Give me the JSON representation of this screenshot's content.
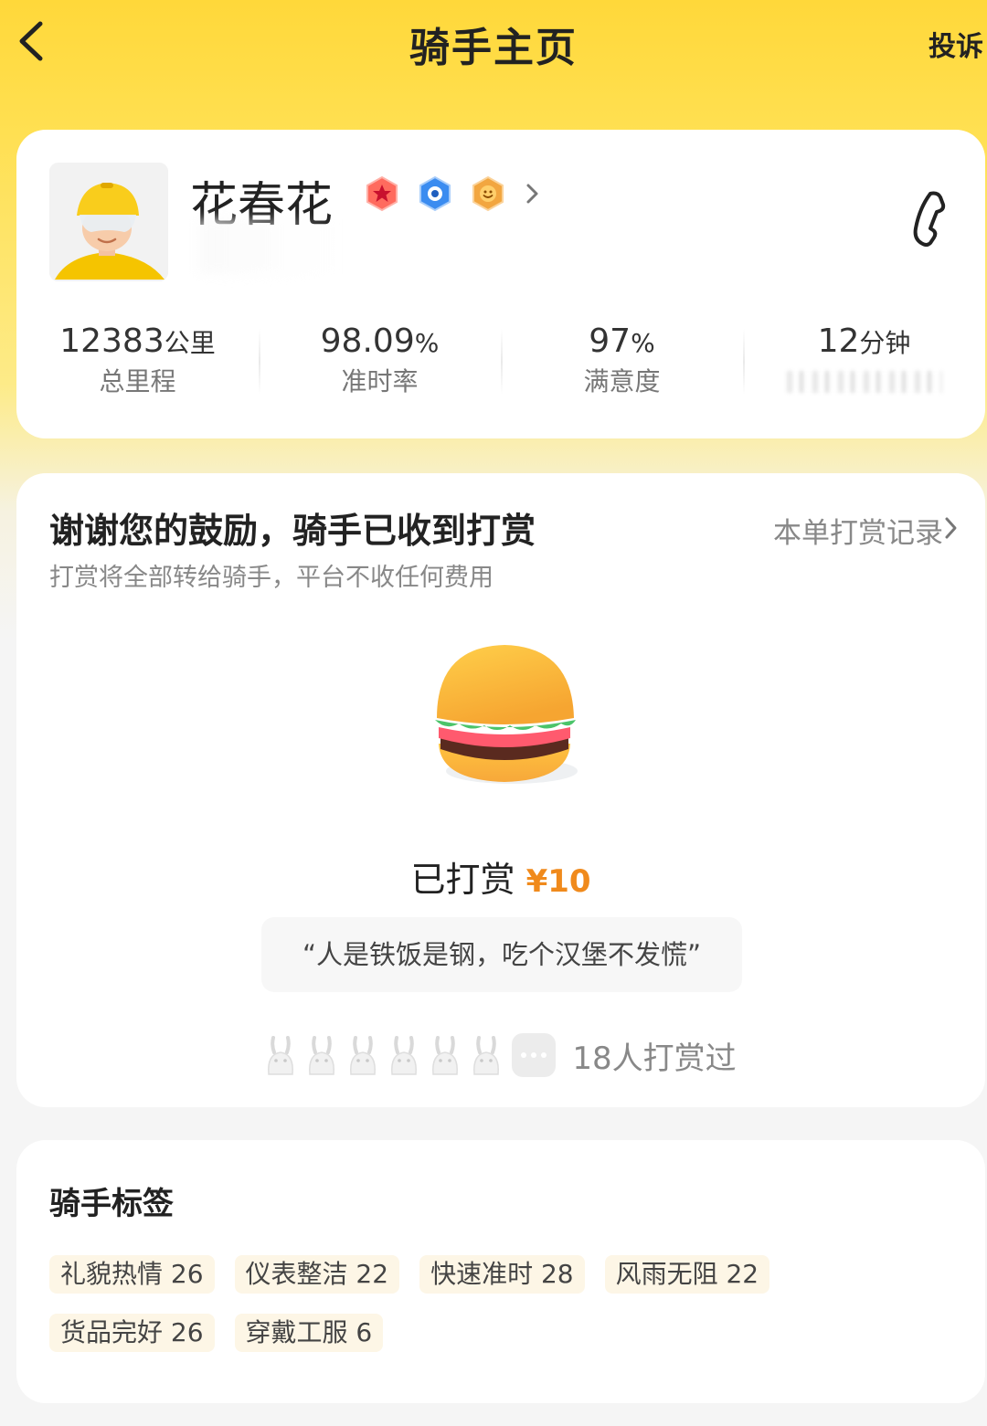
{
  "header": {
    "title": "骑手主页",
    "complain_label": "投诉"
  },
  "rider": {
    "name": "花春花",
    "badges": [
      "red-star-badge-icon",
      "blue-badge-icon",
      "orange-smile-badge-icon"
    ],
    "stats": [
      {
        "value": "12383",
        "unit": "公里",
        "label": "总里程"
      },
      {
        "value": "98.09",
        "unit": "%",
        "label": "准时率"
      },
      {
        "value": "97",
        "unit": "%",
        "label": "满意度"
      },
      {
        "value": "12",
        "unit": "分钟",
        "label": ""
      }
    ]
  },
  "reward": {
    "heading": "谢谢您的鼓励，骑手已收到打赏",
    "subtitle": "打赏将全部转给骑手，平台不收任何费用",
    "record_link": "本单打赏记录",
    "done_label": "已打赏",
    "amount": "¥10",
    "quote": "“人是铁饭是钢，吃个汉堡不发慌”",
    "tipper_count_label": "18人打赏过",
    "amount_color": "#f08a1c"
  },
  "tags": {
    "title": "骑手标签",
    "items": [
      "礼貌热情 26",
      "仪表整洁 22",
      "快速准时 28",
      "风雨无阻 22",
      "货品完好 26",
      "穿戴工服 6"
    ]
  },
  "colors": {
    "brand_yellow": "#ffd83a",
    "tag_bg": "#fdf6e6"
  }
}
